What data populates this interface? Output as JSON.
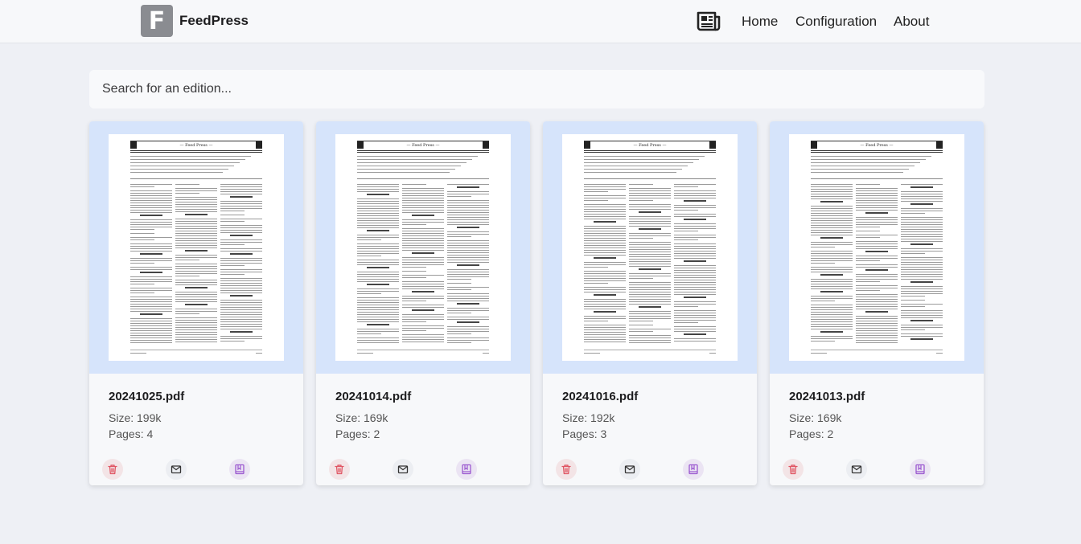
{
  "brand": {
    "logo_letter": "F",
    "name": "FeedPress"
  },
  "nav": {
    "home": "Home",
    "configuration": "Configuration",
    "about": "About"
  },
  "search": {
    "placeholder": "Search for an edition...",
    "value": ""
  },
  "colors": {
    "thumb_bg": "#d6e4fb",
    "delete": "#e05563",
    "mail": "#333333",
    "book": "#9b59d0"
  },
  "editions": [
    {
      "file": "20241025.pdf",
      "size": "Size: 199k",
      "pages": "Pages: 4"
    },
    {
      "file": "20241014.pdf",
      "size": "Size: 169k",
      "pages": "Pages: 2"
    },
    {
      "file": "20241016.pdf",
      "size": "Size: 192k",
      "pages": "Pages: 3"
    },
    {
      "file": "20241013.pdf",
      "size": "Size: 169k",
      "pages": "Pages: 2"
    }
  ],
  "thumbnail": {
    "masthead": "— Feed Press —"
  },
  "icons": {
    "nav": "newspaper-icon",
    "delete": "trash-icon",
    "mail": "mail-icon",
    "book": "book-icon"
  }
}
